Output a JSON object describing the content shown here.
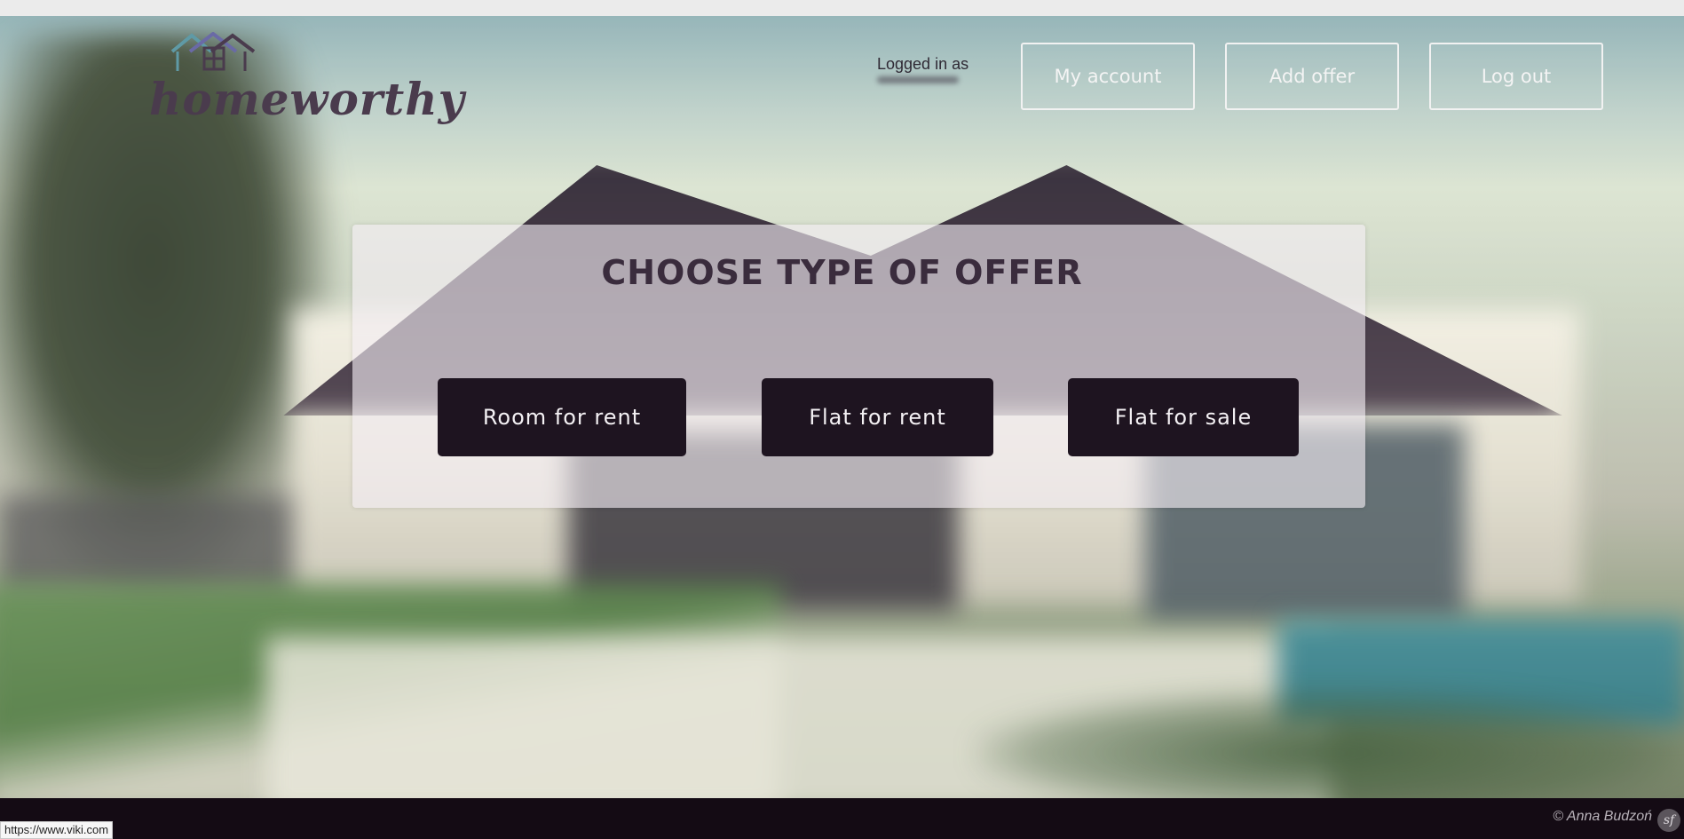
{
  "brand": {
    "name": "homeworthy"
  },
  "header": {
    "logged_in_label": "Logged in as",
    "nav": [
      {
        "label": "My account"
      },
      {
        "label": "Add offer"
      },
      {
        "label": "Log out"
      }
    ]
  },
  "panel": {
    "title": "CHOOSE  TYPE  OF  OFFER",
    "options": [
      {
        "label": "Room for rent"
      },
      {
        "label": "Flat for rent"
      },
      {
        "label": "Flat for sale"
      }
    ]
  },
  "footer": {
    "credit": "© Anna Budzoń",
    "framework_icon": "sf"
  },
  "statusbar": {
    "url": "https://www.viki.com"
  },
  "colors": {
    "brand": "#4a3b4d",
    "button_dark": "#1e1420",
    "footer_bg": "#140b14"
  }
}
